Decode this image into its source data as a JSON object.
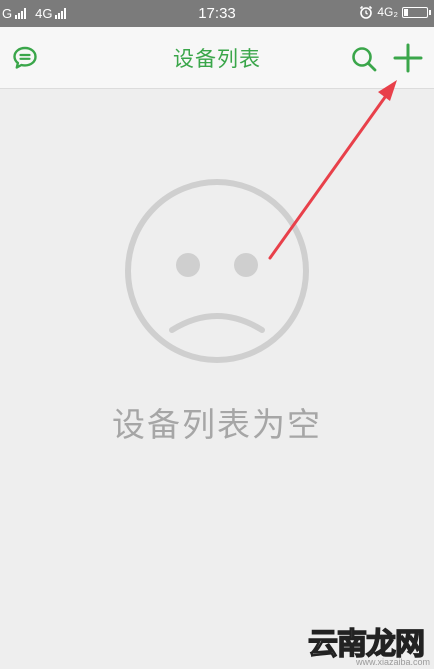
{
  "status_bar": {
    "carrier_1": "G",
    "carrier_2": "4G",
    "time": "17:33",
    "network_right": "4G₂"
  },
  "app_bar": {
    "title": "设备列表",
    "icons": {
      "left": "chat-bubble-icon",
      "search": "search-icon",
      "add": "plus-icon"
    },
    "accent_color": "#3aa64a"
  },
  "empty_state": {
    "icon": "sad-face-icon",
    "message": "设备列表为空"
  },
  "annotation": {
    "type": "red-arrow",
    "color": "#e8404a",
    "points_to": "add-device-button"
  },
  "watermark": {
    "brand": "云南龙网",
    "url": "www.xiazaiba.com"
  }
}
